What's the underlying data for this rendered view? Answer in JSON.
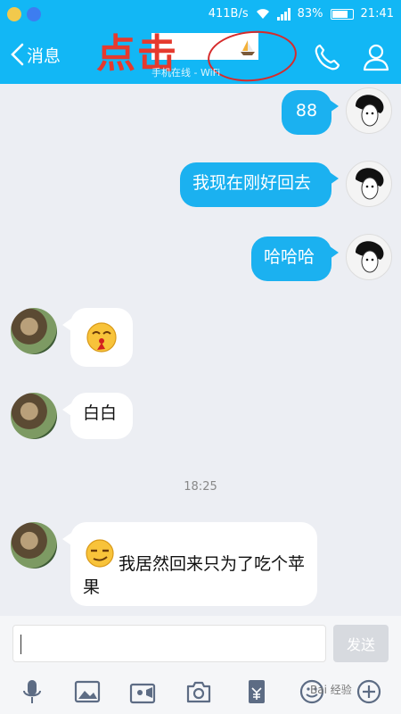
{
  "status_bar": {
    "network_speed": "411B/s",
    "battery_percent": "83%",
    "time": "21:41",
    "battery_level": 0.83
  },
  "header": {
    "back_label": "消息",
    "subtitle": "手机在线 - WiFi",
    "annotation_text": "点击",
    "icons": [
      "chevron-left-icon",
      "sailboat-icon",
      "phone-icon",
      "profile-icon"
    ]
  },
  "messages": [
    {
      "from": "me",
      "text": "88"
    },
    {
      "from": "me",
      "text": "我现在刚好回去"
    },
    {
      "from": "me",
      "text": "哈哈哈"
    },
    {
      "from": "them",
      "emoji": "nosebleed-emoji"
    },
    {
      "from": "them",
      "text": "白白"
    },
    {
      "from": "them",
      "emoji": "smirk-emoji",
      "text": "我居然回来只为了吃个苹果"
    }
  ],
  "timestamp": "18:25",
  "composer": {
    "input_value": "",
    "send_label": "发送"
  },
  "toolbar": {
    "icons": [
      "microphone-icon",
      "image-icon",
      "video-call-icon",
      "camera-icon",
      "red-packet-icon",
      "emoji-icon",
      "plus-icon"
    ]
  },
  "colors": {
    "header": "#12b7f5",
    "outgoing_bubble": "#1bb1f0",
    "incoming_bubble": "#ffffff",
    "annotation": "#e53a2e",
    "background": "#eceef3"
  },
  "watermark": "Bai 经验"
}
